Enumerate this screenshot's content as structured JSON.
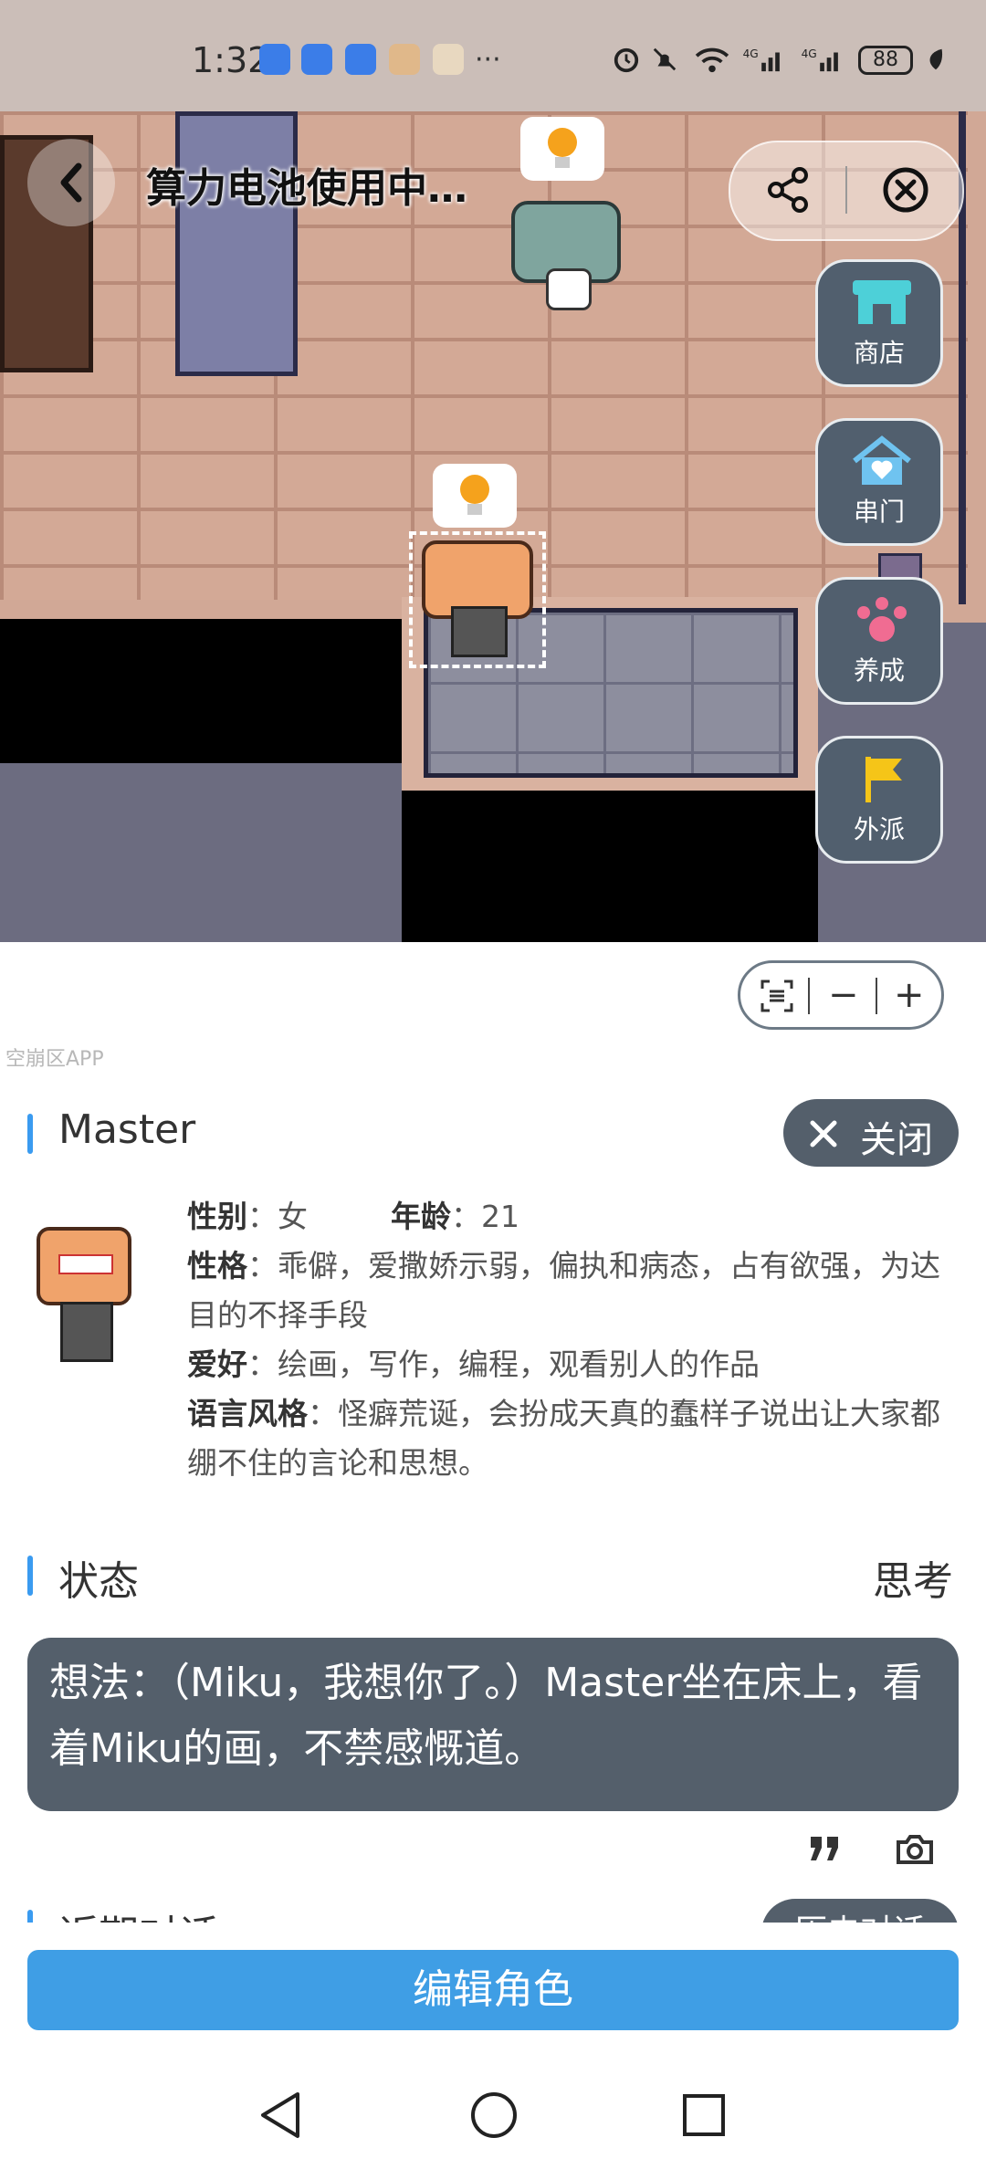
{
  "status_bar": {
    "time": "1:32",
    "overflow": "···",
    "battery": "88",
    "icons": [
      "alarm-icon",
      "mute-icon",
      "wifi-icon",
      "signal-4g-icon",
      "signal-4g-icon",
      "leaf-icon"
    ]
  },
  "game": {
    "title": "算力电池使用中…",
    "side_buttons": [
      {
        "label": "商店",
        "icon": "shop-icon"
      },
      {
        "label": "串门",
        "icon": "house-heart-icon"
      },
      {
        "label": "养成",
        "icon": "paw-icon"
      },
      {
        "label": "外派",
        "icon": "flag-icon"
      }
    ],
    "zoom": {
      "minus": "−",
      "plus": "+"
    }
  },
  "watermark": "空崩区APP",
  "profile": {
    "name": "Master",
    "close_label": "关闭",
    "gender_label": "性别",
    "gender": "女",
    "age_label": "年龄",
    "age": "21",
    "personality_label": "性格",
    "personality": "乖僻，爱撒娇示弱，偏执和病态，占有欲强，为达目的不择手段",
    "hobby_label": "爱好",
    "hobby": "绘画，写作，编程，观看别人的作品",
    "style_label": "语言风格",
    "style": "怪癖荒诞，会扮成天真的蠢样子说出让大家都绷不住的言论和思想。"
  },
  "status": {
    "title": "状态",
    "state": "思考",
    "thought": "想法：（Miku，我想你了。）Master坐在床上，看着Miku的画，不禁感慨道。"
  },
  "recent": {
    "title": "近期对话",
    "history_label": "历史对话"
  },
  "edit_button": "编辑角色",
  "colors": {
    "accent": "#3f9ee5",
    "dark_panel": "#545f6b",
    "shop_teal": "#4dd0d8",
    "paw_pink": "#f06c92",
    "flag_yellow": "#f5c518"
  }
}
